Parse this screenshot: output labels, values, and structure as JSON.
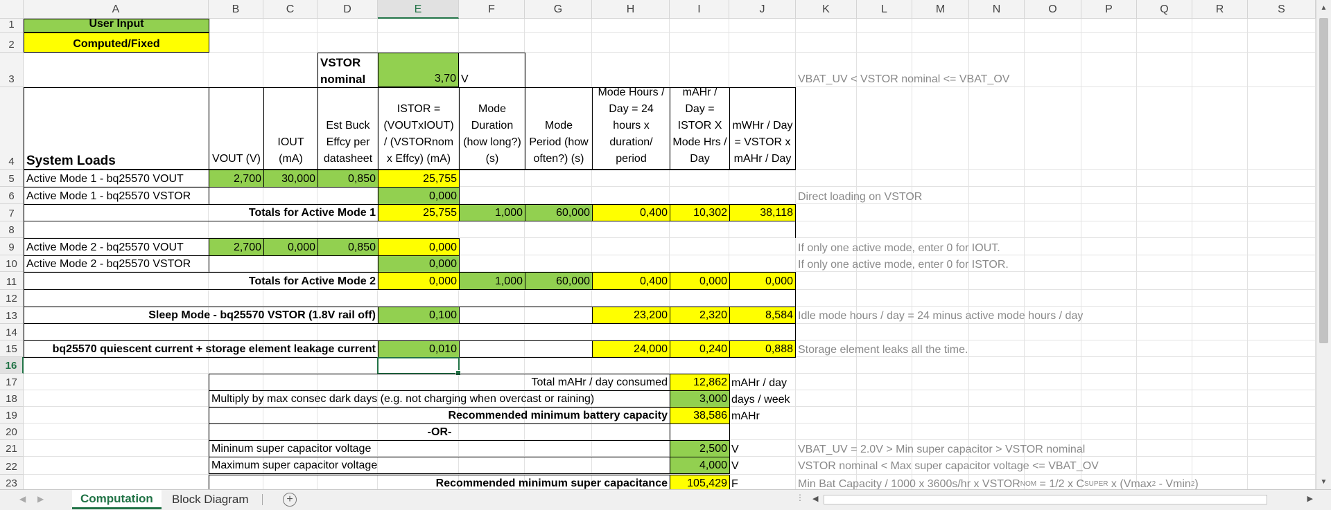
{
  "columns": [
    "A",
    "B",
    "C",
    "D",
    "E",
    "F",
    "G",
    "H",
    "I",
    "J",
    "K",
    "L",
    "M",
    "N",
    "O",
    "P",
    "Q",
    "R",
    "S"
  ],
  "rows": [
    "1",
    "2",
    "3",
    "4",
    "5",
    "6",
    "7",
    "8",
    "9",
    "10",
    "11",
    "12",
    "13",
    "14",
    "15",
    "16",
    "17",
    "18",
    "19",
    "20",
    "21",
    "22",
    "23"
  ],
  "selected_cell": {
    "col": "E",
    "row": "16"
  },
  "legend": {
    "user_input": "User Input",
    "computed": "Computed/Fixed"
  },
  "colors": {
    "input": "#92d050",
    "computed": "#ffff00",
    "accent": "#217346",
    "note": "#8a8a8a"
  },
  "vstor": {
    "label": "VSTOR nominal",
    "value": "3,70",
    "unit": "V",
    "note": "VBAT_UV < VSTOR nominal <= VBAT_OV"
  },
  "headers": {
    "system_loads": "System Loads",
    "vout": "VOUT (V)",
    "iout": "IOUT (mA)",
    "effcy": "Est Buck Effcy per datasheet",
    "istor": "ISTOR = (VOUTxIOUT) / (VSTORnom x Effcy) (mA)",
    "duration": "Mode Duration (how long?) (s)",
    "period": "Mode Period (how often?) (s)",
    "hours": "Mode Hours / Day = 24 hours x duration/ period",
    "mahr": "mAHr / Day = ISTOR X Mode Hrs / Day",
    "mwhr": "mWHr / Day = VSTOR x mAHr / Day"
  },
  "r5": {
    "label": "Active Mode 1 - bq25570 VOUT",
    "vout": "2,700",
    "iout": "30,000",
    "eff": "0,850",
    "istor": "25,755"
  },
  "r6": {
    "label": "Active Mode 1 - bq25570 VSTOR",
    "istor": "0,000",
    "note": "Direct loading on VSTOR"
  },
  "r7": {
    "label": "Totals for Active Mode 1",
    "istor": "25,755",
    "dur": "1,000",
    "per": "60,000",
    "hrs": "0,400",
    "mahr": "10,302",
    "mwhr": "38,118"
  },
  "r9": {
    "label": "Active Mode 2 - bq25570 VOUT",
    "vout": "2,700",
    "iout": "0,000",
    "eff": "0,850",
    "istor": "0,000",
    "note": "If only one active mode, enter 0 for IOUT."
  },
  "r10": {
    "label": "Active Mode 2 - bq25570 VSTOR",
    "istor": "0,000",
    "note": "If only one active mode, enter 0 for ISTOR."
  },
  "r11": {
    "label": "Totals for Active Mode 2",
    "istor": "0,000",
    "dur": "1,000",
    "per": "60,000",
    "hrs": "0,400",
    "mahr": "0,000",
    "mwhr": "0,000"
  },
  "r13": {
    "label": "Sleep Mode - bq25570 VSTOR (1.8V rail off)",
    "istor": "0,100",
    "hrs": "23,200",
    "mahr": "2,320",
    "mwhr": "8,584",
    "note": "Idle mode hours / day = 24 minus active mode hours / day"
  },
  "r15": {
    "label": "bq25570 quiescent current + storage element leakage current",
    "istor": "0,010",
    "hrs": "24,000",
    "mahr": "0,240",
    "mwhr": "0,888",
    "note": "Storage element leaks all the time."
  },
  "r17": {
    "label": "Total mAHr / day consumed",
    "value": "12,862",
    "unit": "mAHr / day"
  },
  "r18": {
    "label": "Multiply by max consec dark days (e.g. not charging when overcast or raining)",
    "value": "3,000",
    "unit": "days / week"
  },
  "r19": {
    "label": "Recommended minimum battery capacity",
    "value": "38,586",
    "unit": "mAHr"
  },
  "r20": {
    "label": "-OR-"
  },
  "r21": {
    "label": "Mininum super capacitor voltage",
    "value": "2,500",
    "unit": "V",
    "note": "VBAT_UV = 2.0V > Min super capacitor > VSTOR nominal"
  },
  "r22": {
    "label": "Maximum super capacitor voltage",
    "value": "4,000",
    "unit": "V",
    "note": "VSTOR nominal < Max super capacitor voltage <= VBAT_OV"
  },
  "r23": {
    "label": "Recommended minimum super capacitance",
    "value": "105,429",
    "unit": "F",
    "note_p1": "Min Bat Capacity / 1000 x 3600s/hr x VSTOR",
    "note_sub1": "NOM",
    "note_p2": " = 1/2 x C",
    "note_sub2": "SUPER",
    "note_p3": " x (Vmax",
    "note_sup1": "2",
    "note_p4": " - Vmin",
    "note_sup2": "2",
    "note_p5": ")"
  },
  "tabs": [
    {
      "label": "Computation",
      "active": true
    },
    {
      "label": "Block Diagram",
      "active": false
    }
  ],
  "add_sheet": "+"
}
